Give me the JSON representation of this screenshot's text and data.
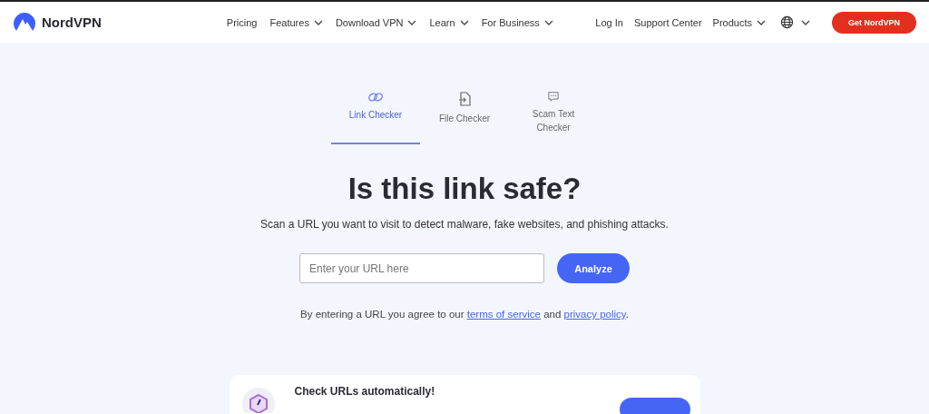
{
  "header": {
    "logo": "NordVPN",
    "nav": [
      {
        "label": "Pricing",
        "dropdown": false
      },
      {
        "label": "Features",
        "dropdown": true
      },
      {
        "label": "Download VPN",
        "dropdown": true
      },
      {
        "label": "Learn",
        "dropdown": true
      },
      {
        "label": "For Business",
        "dropdown": true
      }
    ],
    "right": [
      {
        "label": "Log In",
        "dropdown": false
      },
      {
        "label": "Support Center",
        "dropdown": false
      },
      {
        "label": "Products",
        "dropdown": true
      }
    ],
    "cta": "Get NordVPN"
  },
  "tabs": [
    {
      "label": "Link Checker",
      "kind": "link",
      "selected": true
    },
    {
      "label": "File Checker",
      "kind": "file",
      "selected": false
    },
    {
      "label": "Scam Text Checker",
      "kind": "chat",
      "selected": false
    }
  ],
  "title": "Is this link safe?",
  "subtitle": "Scan a URL you want to visit to detect malware, fake websites, and phishing attacks.",
  "search": {
    "placeholder": "Enter your URL here",
    "button": "Analyze"
  },
  "agreement": {
    "before": "By entering a URL you agree to our ",
    "link1": "terms of service",
    "middle": " and ",
    "link2": "privacy policy",
    "after": "."
  },
  "banner": {
    "title": "Check URLs automatically!"
  }
}
